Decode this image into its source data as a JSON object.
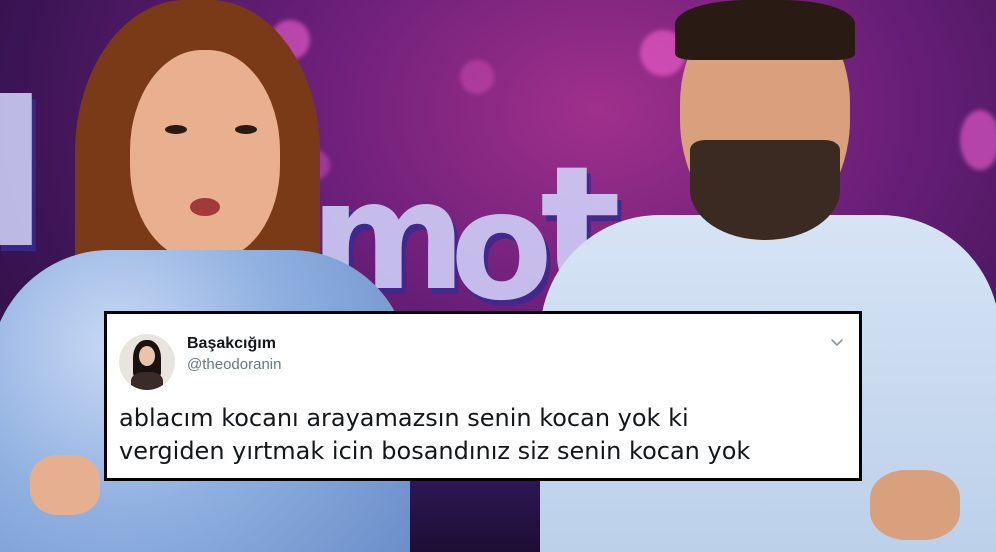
{
  "tweet": {
    "display_name": "Başakcığım",
    "handle": "@theodoranin",
    "lines": [
      "ablacım kocanı arayamazsın senin kocan yok ki",
      "vergiden yırtmak icin bosandınız siz senin kocan yok"
    ],
    "menu_icon": "chevron-down-icon"
  },
  "colors": {
    "card_bg": "#ffffff",
    "card_border": "#000000",
    "name_text": "#14171a",
    "handle_text": "#657786",
    "studio_bg": "#6a1f78"
  }
}
